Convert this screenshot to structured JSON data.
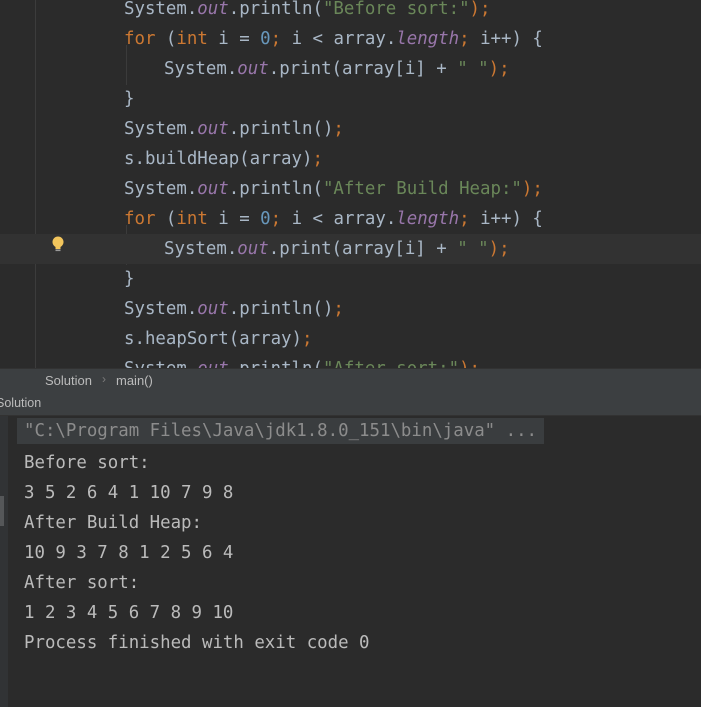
{
  "editor": {
    "lines": [
      {
        "parts": [
          {
            "t": "System.",
            "c": ""
          },
          {
            "t": "out",
            "c": "fld"
          },
          {
            "t": ".println(",
            "c": ""
          },
          {
            "t": "\"Before sort:\"",
            "c": "str"
          },
          {
            "t": ");",
            "c": "kw"
          }
        ]
      },
      {
        "parts": [
          {
            "t": "for",
            "c": "kw"
          },
          {
            "t": " (",
            "c": ""
          },
          {
            "t": "int",
            "c": "kw"
          },
          {
            "t": " i = ",
            "c": ""
          },
          {
            "t": "0",
            "c": "num"
          },
          {
            "t": "; ",
            "c": "kw"
          },
          {
            "t": "i < array.",
            "c": ""
          },
          {
            "t": "length",
            "c": "fld"
          },
          {
            "t": "; ",
            "c": "kw"
          },
          {
            "t": "i++) {",
            "c": ""
          }
        ]
      },
      {
        "parts": [
          {
            "t": "System.",
            "c": ""
          },
          {
            "t": "out",
            "c": "fld"
          },
          {
            "t": ".print(array[i] + ",
            "c": ""
          },
          {
            "t": "\" \"",
            "c": "str"
          },
          {
            "t": ");",
            "c": "kw"
          }
        ]
      },
      {
        "parts": [
          {
            "t": "}",
            "c": ""
          }
        ]
      },
      {
        "parts": [
          {
            "t": "System.",
            "c": ""
          },
          {
            "t": "out",
            "c": "fld"
          },
          {
            "t": ".println()",
            "c": ""
          },
          {
            "t": ";",
            "c": "kw"
          }
        ]
      },
      {
        "parts": [
          {
            "t": "s.buildHeap(array)",
            "c": ""
          },
          {
            "t": ";",
            "c": "kw"
          }
        ]
      },
      {
        "parts": [
          {
            "t": "System.",
            "c": ""
          },
          {
            "t": "out",
            "c": "fld"
          },
          {
            "t": ".println(",
            "c": ""
          },
          {
            "t": "\"After Build Heap:\"",
            "c": "str"
          },
          {
            "t": ");",
            "c": "kw"
          }
        ]
      },
      {
        "parts": [
          {
            "t": "for",
            "c": "kw"
          },
          {
            "t": " (",
            "c": ""
          },
          {
            "t": "int",
            "c": "kw"
          },
          {
            "t": " i = ",
            "c": ""
          },
          {
            "t": "0",
            "c": "num"
          },
          {
            "t": "; ",
            "c": "kw"
          },
          {
            "t": "i < array.",
            "c": ""
          },
          {
            "t": "length",
            "c": "fld"
          },
          {
            "t": "; ",
            "c": "kw"
          },
          {
            "t": "i++) {",
            "c": ""
          }
        ]
      },
      {
        "parts": [
          {
            "t": "System.",
            "c": ""
          },
          {
            "t": "out",
            "c": "fld"
          },
          {
            "t": ".print(array[i] + ",
            "c": ""
          },
          {
            "t": "\" \"",
            "c": "str"
          },
          {
            "t": ");",
            "c": "kw"
          }
        ]
      },
      {
        "parts": [
          {
            "t": "}",
            "c": ""
          }
        ]
      },
      {
        "parts": [
          {
            "t": "System.",
            "c": ""
          },
          {
            "t": "out",
            "c": "fld"
          },
          {
            "t": ".println()",
            "c": ""
          },
          {
            "t": ";",
            "c": "kw"
          }
        ]
      },
      {
        "parts": [
          {
            "t": "s.heapSort(array)",
            "c": ""
          },
          {
            "t": ";",
            "c": "kw"
          }
        ]
      },
      {
        "parts": [
          {
            "t": "System.",
            "c": ""
          },
          {
            "t": "out",
            "c": "fld"
          },
          {
            "t": ".println(",
            "c": ""
          },
          {
            "t": "\"After sort:\"",
            "c": "str"
          },
          {
            "t": ");",
            "c": "kw"
          }
        ]
      }
    ]
  },
  "breadcrumb": {
    "class_name": "Solution",
    "method_name": "main()"
  },
  "run_panel": {
    "title": "Solution",
    "command": "\"C:\\Program Files\\Java\\jdk1.8.0_151\\bin\\java\" ...",
    "output": [
      "Before sort:",
      "3 5 2 6 4 1 10 7 9 8",
      "After Build Heap:",
      "10 9 3 7 8 1 2 5 6 4",
      "After sort:",
      "1 2 3 4 5 6 7 8 9 10",
      "Process finished with exit code 0"
    ]
  },
  "colors": {
    "background": "#2b2b2b",
    "keyword": "#cc7832",
    "field": "#9876aa",
    "number": "#6897bb",
    "string": "#6a8759",
    "text": "#a9b7c6",
    "tool_bar": "#3c3f41"
  },
  "icons": {
    "intention": "lightbulb-icon",
    "separator": "chevron-right-icon"
  }
}
